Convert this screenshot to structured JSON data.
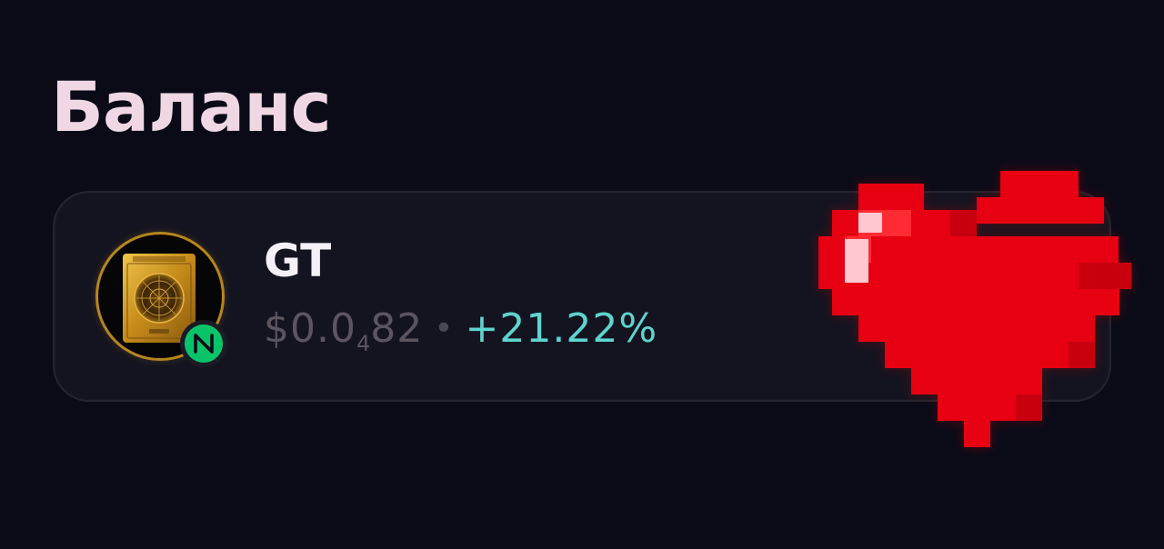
{
  "header": {
    "title": "Баланс"
  },
  "token": {
    "symbol": "GT",
    "price_prefix": "$0.0",
    "price_subscript": "4",
    "price_suffix": "82",
    "separator": "•",
    "change": "+21.22%",
    "avatar_icon": "golden-ticket-icon",
    "network_icon": "near-network-icon"
  },
  "colors": {
    "background": "#0b0b18",
    "title": "#efd8e4",
    "card": "#141420",
    "price": "#5b5560",
    "change_positive": "#5ed4cd",
    "network_badge": "#08c468",
    "heart": "#e60012"
  },
  "decorations": {
    "sticker": "pixel-heart-icon"
  }
}
